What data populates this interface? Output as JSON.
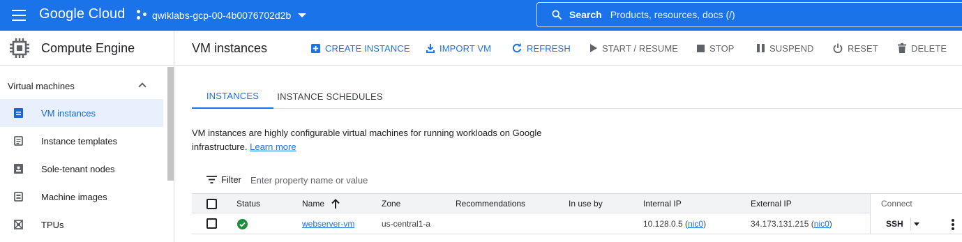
{
  "topbar": {
    "logo": "Google Cloud",
    "project": "qwiklabs-gcp-00-4b0076702d2b",
    "search_label": "Search",
    "search_placeholder": "Products, resources, docs (/)",
    "bg_color": "#1a73e8"
  },
  "sidebar": {
    "product": "Compute Engine",
    "section": "Virtual machines",
    "items": [
      {
        "label": "VM instances",
        "icon": "vm-instances-icon",
        "active": true
      },
      {
        "label": "Instance templates",
        "icon": "instance-templates-icon",
        "active": false
      },
      {
        "label": "Sole-tenant nodes",
        "icon": "sole-tenant-nodes-icon",
        "active": false
      },
      {
        "label": "Machine images",
        "icon": "machine-images-icon",
        "active": false
      },
      {
        "label": "TPUs",
        "icon": "tpus-icon",
        "active": false
      }
    ]
  },
  "header": {
    "title": "VM instances",
    "actions": {
      "create": "CREATE INSTANCE",
      "import": "IMPORT VM",
      "refresh": "REFRESH",
      "start": "START / RESUME",
      "stop": "STOP",
      "suspend": "SUSPEND",
      "reset": "RESET",
      "delete": "DELETE"
    }
  },
  "tabs": {
    "instances": "INSTANCES",
    "schedules": "INSTANCE SCHEDULES"
  },
  "description": {
    "text": "VM instances are highly configurable virtual machines for running workloads on Google infrastructure.",
    "link": "Learn more"
  },
  "filter": {
    "label": "Filter",
    "placeholder": "Enter property name or value"
  },
  "table": {
    "columns": {
      "status": "Status",
      "name": "Name",
      "zone": "Zone",
      "recommendations": "Recommendations",
      "in_use_by": "In use by",
      "internal_ip": "Internal IP",
      "external_ip": "External IP",
      "connect": "Connect"
    },
    "rows": [
      {
        "status": "running",
        "name": "webserver-vm",
        "zone": "us-central1-a",
        "recommendations": "",
        "in_use_by": "",
        "internal_ip": "10.128.0.5",
        "internal_nic": "nic0",
        "external_ip": "34.173.131.215",
        "external_nic": "nic0",
        "connect": "SSH"
      }
    ]
  },
  "colors": {
    "accent": "#1a73e8",
    "status_ok": "#1e8e3e"
  }
}
